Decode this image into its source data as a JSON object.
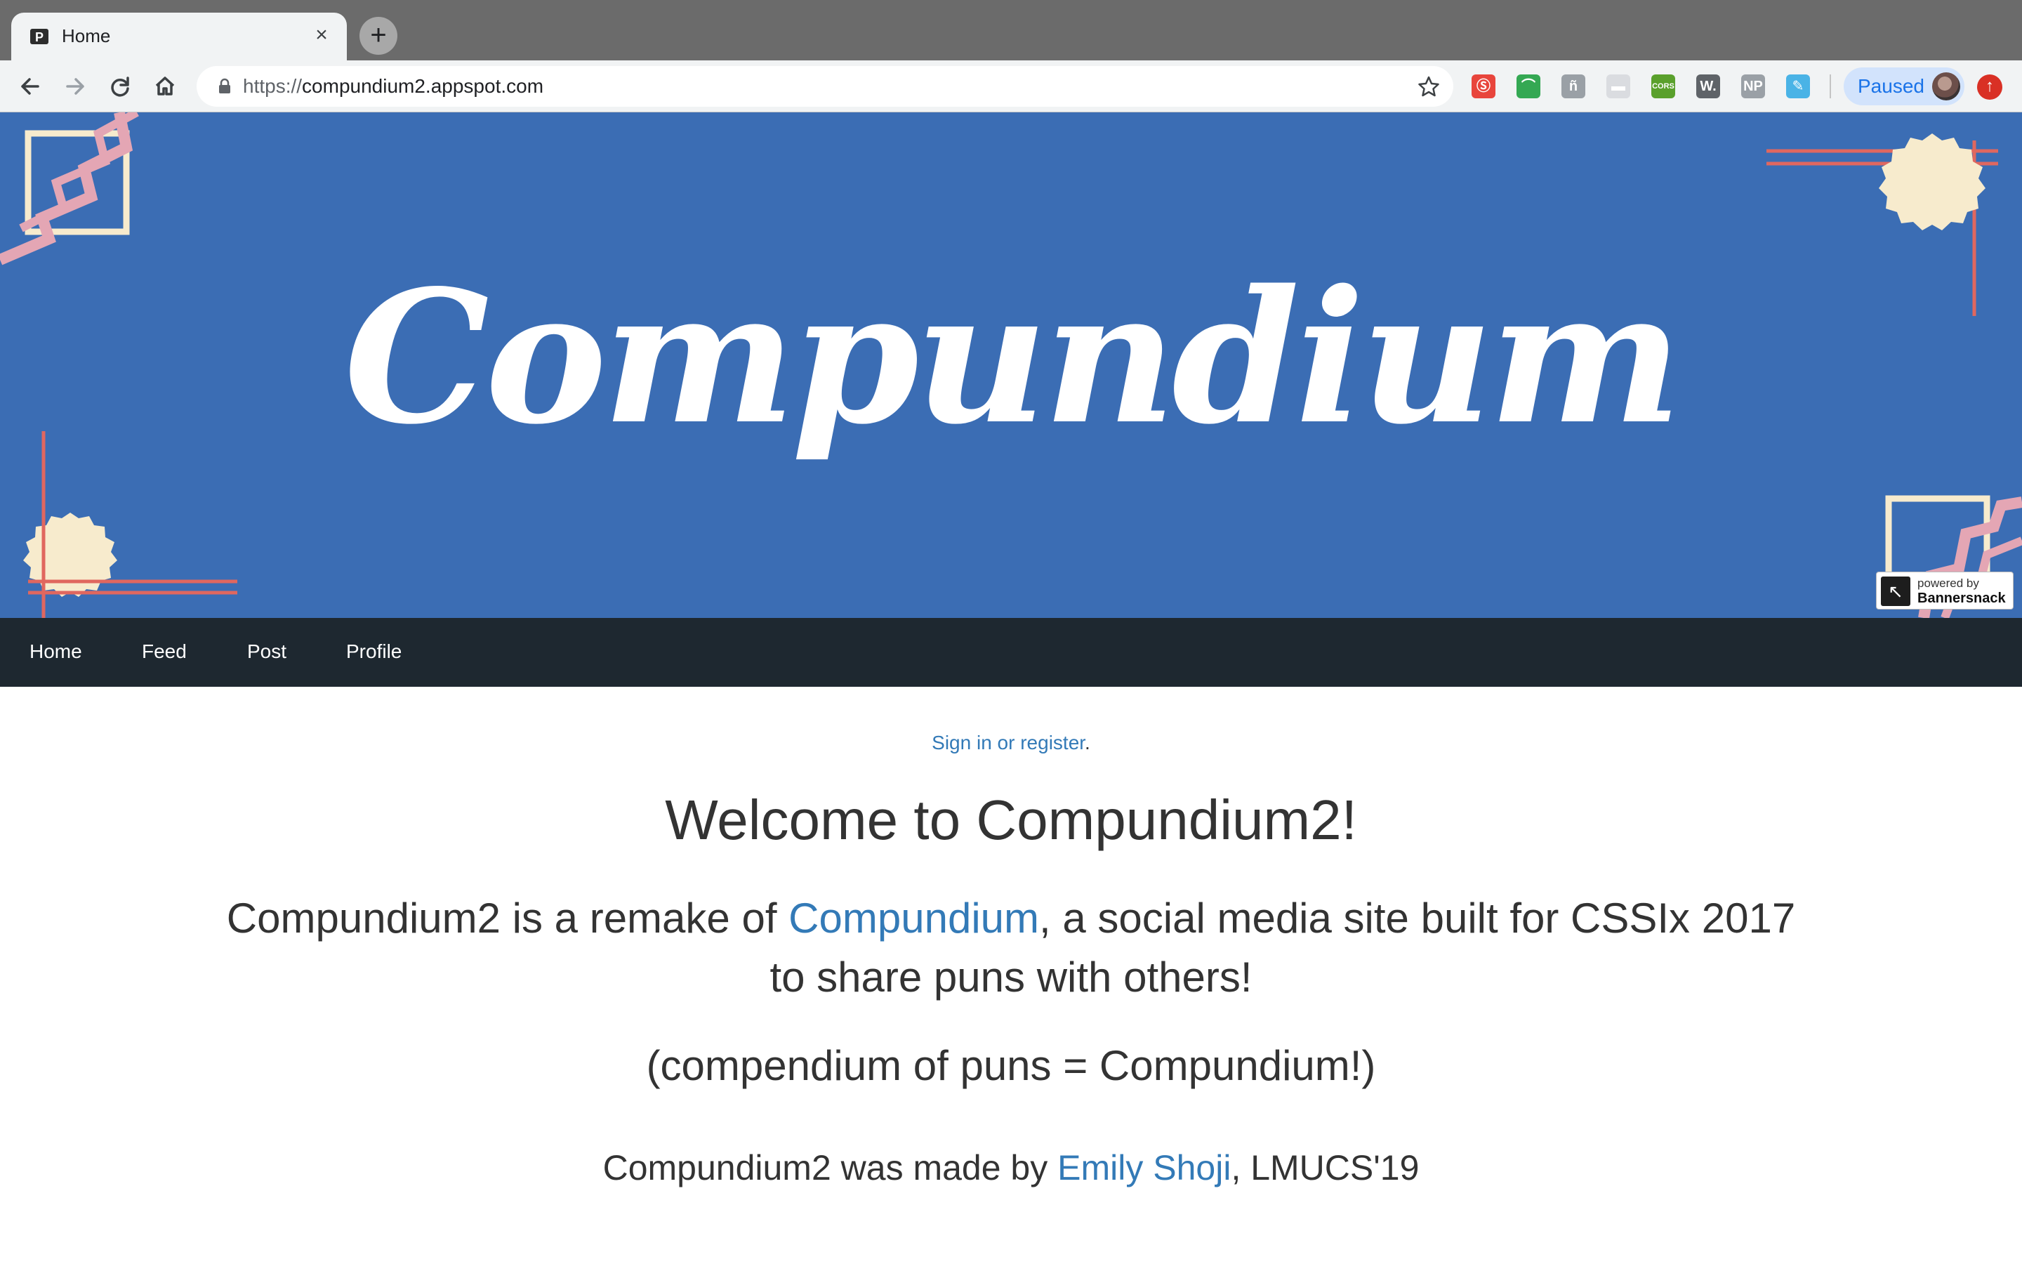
{
  "browser": {
    "tab_title": "Home",
    "tab_close": "×",
    "new_tab": "+",
    "url_scheme": "https://",
    "url_host": "compundium2.appspot.com",
    "profile_status": "Paused",
    "extensions": [
      {
        "name": "extension-1-icon",
        "label": "Ⓢ",
        "color": "#e8453c"
      },
      {
        "name": "extension-2-icon",
        "label": "⌒",
        "color": "#34a853"
      },
      {
        "name": "extension-3-icon",
        "label": "ñ",
        "color": "#9aa0a6"
      },
      {
        "name": "extension-4-icon",
        "label": "▬",
        "color": "#dadce0"
      },
      {
        "name": "extension-cors-icon",
        "label": "CORS",
        "color": "#5aa02c"
      },
      {
        "name": "extension-w-icon",
        "label": "W.",
        "color": "#5f6368"
      },
      {
        "name": "extension-np-icon",
        "label": "NP",
        "color": "#9aa0a6"
      },
      {
        "name": "extension-8-icon",
        "label": "✎",
        "color": "#4ab3e6"
      }
    ]
  },
  "banner": {
    "logo_text": "Compundium",
    "powered_top": "powered by",
    "powered_bottom": "Bannersnack"
  },
  "nav": {
    "items": [
      "Home",
      "Feed",
      "Post",
      "Profile"
    ]
  },
  "content": {
    "signin_link": "Sign in or register",
    "signin_suffix": ".",
    "welcome": "Welcome to Compundium2!",
    "desc_before": "Compundium2 is a remake of ",
    "desc_link": "Compundium",
    "desc_after": ", a social media site built for CSSIx 2017 to share puns with others!",
    "pun": "(compendium of puns = Compundium!)",
    "madeby_before": "Compundium2 was made by ",
    "madeby_link": "Emily Shoji",
    "madeby_after": ", LMUCS'19"
  },
  "colors": {
    "banner_bg": "#3b6db4",
    "navbar_bg": "#1e2830",
    "link": "#337ab7",
    "accent_pink": "#e4a6b4",
    "accent_red": "#e0675f",
    "accent_cream": "#f7ebcd"
  }
}
